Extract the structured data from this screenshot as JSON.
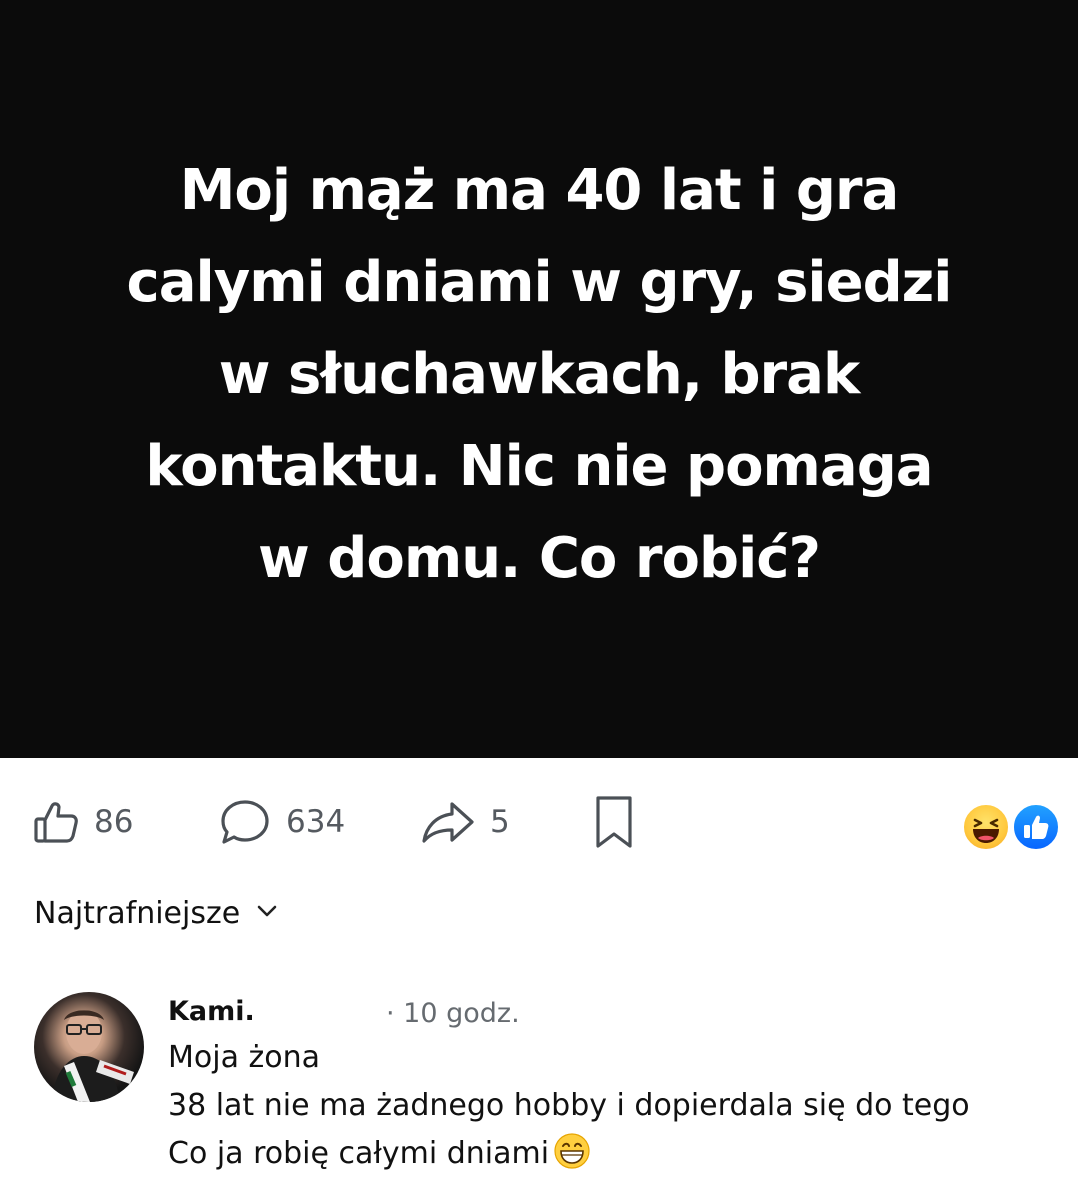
{
  "post": {
    "text_lines": [
      "Moj mąż ma 40 lat i gra",
      "calymi dniami w gry, siedzi",
      "w słuchawkach, brak",
      "kontaktu. Nic nie pomaga",
      "w domu. Co robić?"
    ]
  },
  "actions": {
    "like_count": "86",
    "comment_count": "634",
    "share_count": "5",
    "icons": {
      "like": "thumbs-up-icon",
      "comment": "comment-bubble-icon",
      "share": "share-arrow-icon",
      "save": "bookmark-icon"
    }
  },
  "reactions": {
    "items": [
      "haha-reaction-icon",
      "like-reaction-icon"
    ],
    "colors": {
      "haha": "#ffc83d",
      "like": "#0866ff"
    }
  },
  "sort": {
    "label": "Najtrafniejsze",
    "icon": "chevron-down-icon"
  },
  "comment": {
    "author": "Kami.",
    "time": "· 10 godz.",
    "lines": [
      "Moja żona",
      "38 lat nie ma żadnego hobby i dopierdala się do tego",
      "Co ja robię całymi dniami"
    ],
    "trailing_emoji": "grinning-face-emoji"
  },
  "colors": {
    "post_background": "#0b0b0b",
    "post_text": "#ffffff",
    "secondary_text": "#666b70"
  }
}
